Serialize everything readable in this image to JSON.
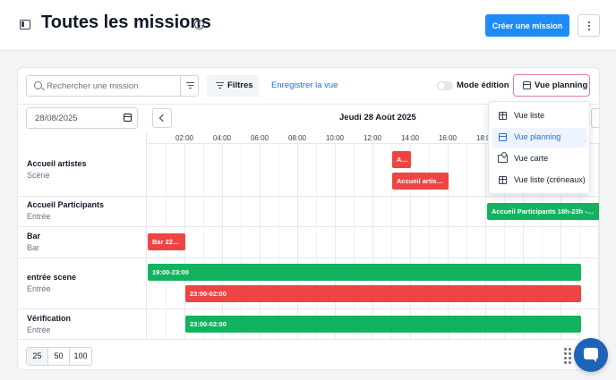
{
  "header": {
    "title": "Toutes les missions",
    "create_label": "Créer une mission"
  },
  "toolbar": {
    "search_placeholder": "Rechercher une mission",
    "filters_label": "Filtres",
    "save_view_label": "Enregistrer la vue",
    "edit_mode_label": "Mode édition",
    "edit_mode_on": false,
    "view_button_label": "Vue planning"
  },
  "planner": {
    "date_value": "28/08/2025",
    "day_label": "Jeudi 28 Août 2025",
    "hours": [
      "02:00",
      "04:00",
      "06:00",
      "08:00",
      "10:00",
      "12:00",
      "14:00",
      "16:00",
      "18:00"
    ],
    "rows": [
      {
        "title": "Accueil artistes",
        "subtitle": "Scène"
      },
      {
        "title": "Accueil Participants",
        "subtitle": "Entrée"
      },
      {
        "title": "Bar",
        "subtitle": "Bar"
      },
      {
        "title": "entrée scene",
        "subtitle": "Entrée"
      },
      {
        "title": "Vérification",
        "subtitle": "Entrée"
      }
    ],
    "shifts": {
      "artistes_short": "A...",
      "artistes_long": "Accueil artist...",
      "participants": "Accueil Participants 18h-23h - 1...",
      "bar": "Bar 22h...",
      "scene_green": "19:00-23:00",
      "scene_red": "23:00-02:00",
      "verif_green": "23:00-02:00"
    }
  },
  "view_menu": {
    "items": [
      {
        "label": "Vue liste",
        "icon": "table-icon"
      },
      {
        "label": "Vue planning",
        "icon": "calendar-icon"
      },
      {
        "label": "Vue carte",
        "icon": "map-icon"
      },
      {
        "label": "Vue liste (créneaux)",
        "icon": "table-icon"
      }
    ],
    "selected": "Vue planning"
  },
  "pagination": {
    "sizes": [
      "25",
      "50",
      "100"
    ],
    "selected": "25"
  },
  "colors": {
    "primary": "#1d8cf8",
    "red_shift": "#ef4444",
    "green_shift": "#12b35f",
    "active_outline": "#e879a9"
  }
}
